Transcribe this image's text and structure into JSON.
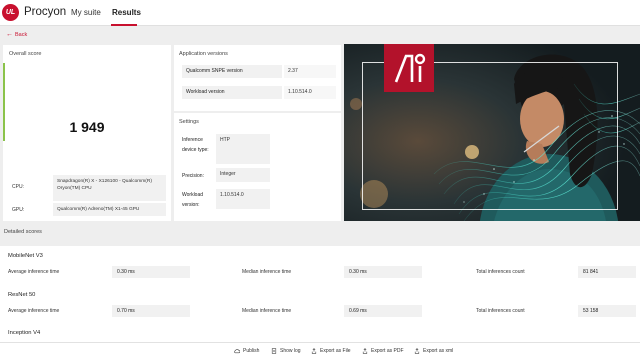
{
  "header": {
    "logo_text": "UL",
    "brand": "Procyon",
    "nav": [
      {
        "label": "My suite"
      },
      {
        "label": "Results"
      }
    ],
    "accent_color": "#c8102e"
  },
  "back_label": "Back",
  "overall": {
    "title": "Overall score",
    "score": "1 949",
    "cpu_label": "CPU:",
    "cpu_value": "Snapdragon(R) X - X126100 - Qualcomm(R) Oryon(TM) CPU",
    "gpu_label": "GPU:",
    "gpu_value": "Qualcomm(R) Adreno(TM) X1-45 GPU",
    "score_bar_color": "#8bc34a"
  },
  "app_versions": {
    "title": "Application versions",
    "rows": [
      {
        "label": "Qualcomm SNPE version",
        "value": "2.37"
      },
      {
        "label": "Workload version",
        "value": "1.10.514.0"
      }
    ]
  },
  "settings": {
    "title": "Settings",
    "rows": [
      {
        "label": "Inference device type:",
        "value": "HTP"
      },
      {
        "label": "Precision:",
        "value": "Integer"
      },
      {
        "label": "Workload version:",
        "value": "1.10.514.0"
      }
    ]
  },
  "detailed": {
    "title": "Detailed scores",
    "sections": [
      {
        "name": "MobileNet V3",
        "avg_label": "Average inference time",
        "avg": "0.30 ms",
        "median_label": "Median inference time",
        "median": "0.30 ms",
        "total_label": "Total inferences count",
        "total": "81 841"
      },
      {
        "name": "ResNet 50",
        "avg_label": "Average inference time",
        "avg": "0.70 ms",
        "median_label": "Median inference time",
        "median": "0.69 ms",
        "total_label": "Total inferences count",
        "total": "53 158"
      },
      {
        "name": "Inception V4"
      }
    ]
  },
  "footer": {
    "buttons": [
      {
        "label": "Publish",
        "icon": "cloud-upload-icon"
      },
      {
        "label": "Show log",
        "icon": "document-icon"
      },
      {
        "label": "Export as File",
        "icon": "export-icon"
      },
      {
        "label": "Export as PDF",
        "icon": "export-icon"
      },
      {
        "label": "Export as xml",
        "icon": "export-icon"
      }
    ]
  }
}
